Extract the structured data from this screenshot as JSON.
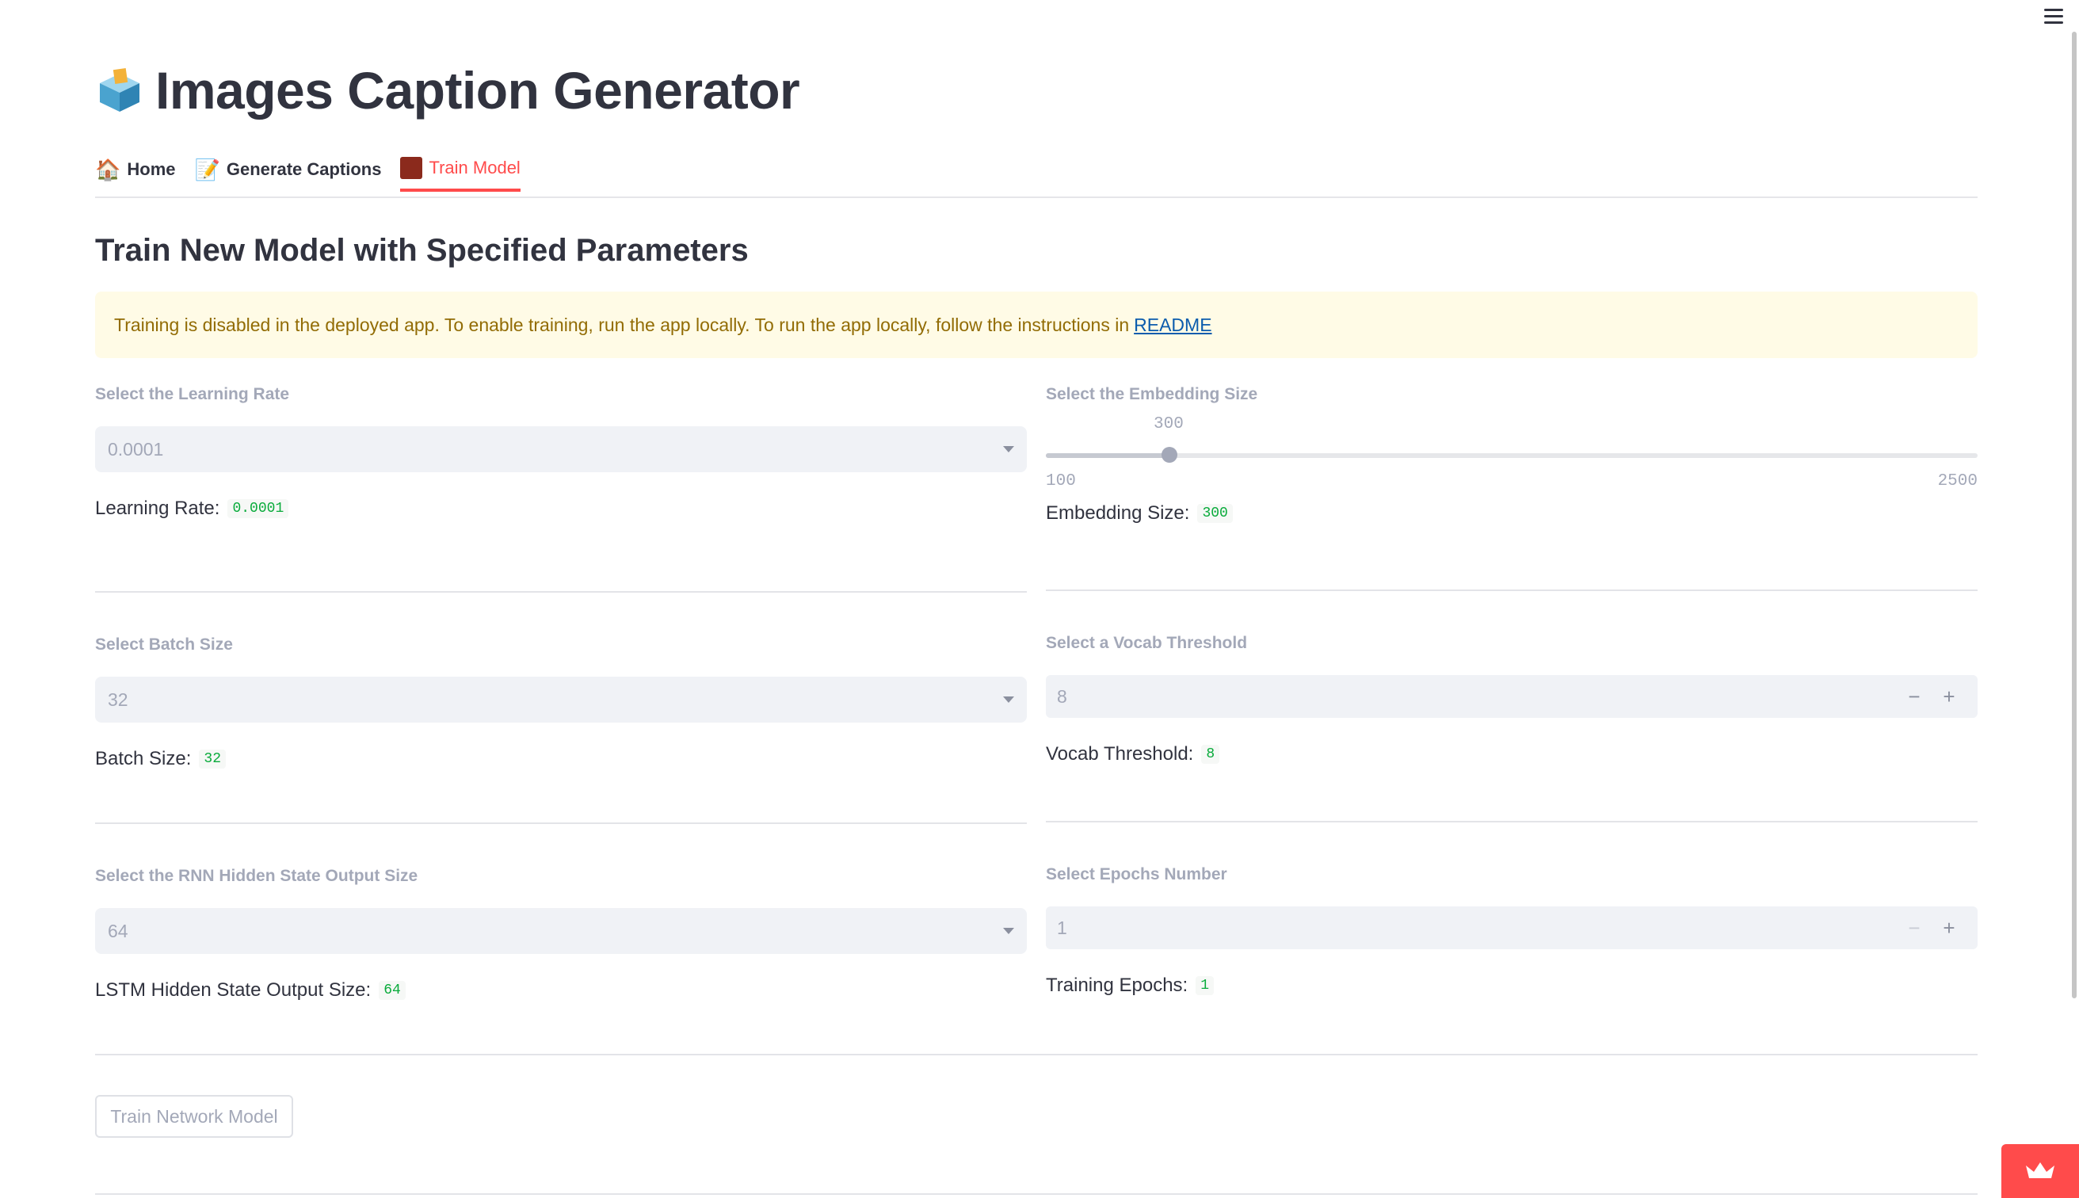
{
  "app": {
    "title": "Images Caption Generator",
    "title_icon": "ballot-box-icon"
  },
  "tabs": [
    {
      "label": "Home",
      "icon": "house-icon",
      "active": false
    },
    {
      "label": "Generate Captions",
      "icon": "memo-icon",
      "active": false
    },
    {
      "label": "Train Model",
      "icon": "abacus-icon",
      "active": true
    }
  ],
  "section": {
    "subheader": "Train New Model with Specified Parameters",
    "warning_text": "Training is disabled in the deployed app. To enable training, run the app locally. To run the app locally, follow the instructions in",
    "warning_link": "README"
  },
  "learning_rate": {
    "label": "Select the Learning Rate",
    "selected": "0.0001",
    "result_label": "Learning Rate:",
    "result_value": "0.0001"
  },
  "embedding_size": {
    "label": "Select the Embedding Size",
    "value": "300",
    "value_num": 300,
    "min": "100",
    "max": "2500",
    "min_num": 100,
    "max_num": 2500,
    "result_label": "Embedding Size:",
    "result_value": "300"
  },
  "batch_size": {
    "label": "Select Batch Size",
    "selected": "32",
    "result_label": "Batch Size:",
    "result_value": "32"
  },
  "vocab_threshold": {
    "label": "Select a Vocab Threshold",
    "value": "8",
    "result_label": "Vocab Threshold:",
    "result_value": "8"
  },
  "hidden_size": {
    "label": "Select the RNN Hidden State Output Size",
    "selected": "64",
    "result_label": "LSTM Hidden State Output Size:",
    "result_value": "64"
  },
  "epochs": {
    "label": "Select Epochs Number",
    "value": "1",
    "result_label": "Training Epochs:",
    "result_value": "1"
  },
  "train_button": {
    "label": "Train Network Model"
  },
  "colors": {
    "accent": "#ff4b4b",
    "warning_bg": "#fffbe6",
    "warning_text": "#926c05",
    "code_green": "#09ab3b"
  }
}
